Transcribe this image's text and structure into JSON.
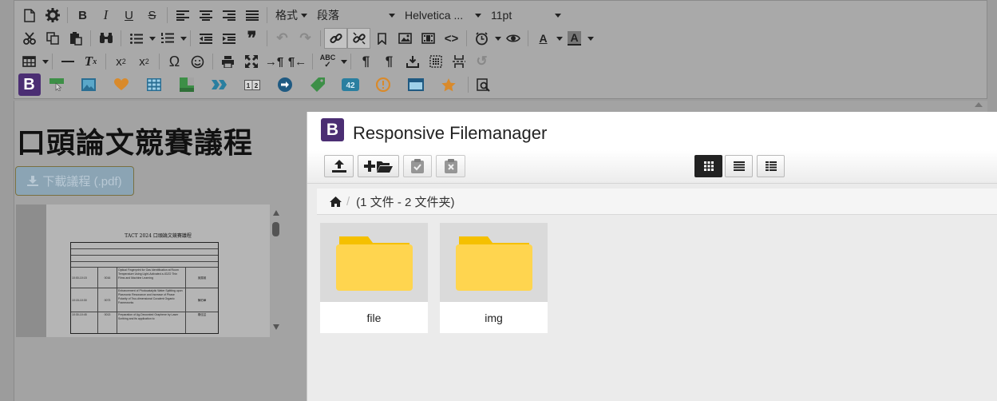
{
  "toolbar": {
    "format_label": "格式",
    "paragraph_label": "段落",
    "font_family": "Helvetica ...",
    "font_size": "11pt"
  },
  "editor": {
    "heading": "口頭論文競賽議程",
    "download_button": "下載議程 (.pdf)",
    "pdf_preview": {
      "title": "TACT 2024  口頭論文競賽議程",
      "rows": [
        {
          "time": "10:00-10:15",
          "id": "0016",
          "paper": "Optical Fingerprint for Gas Identification at Room Temperature Using Light-Activated a-IGZO Thin Films and Machine Learning",
          "speaker": "吳展維"
        },
        {
          "time": "10:15-10:30",
          "id": "0073",
          "paper": "Enhancement of Photocatalytic Water Splitting upon Plasmonic Resonance and Increase of Phase Polarity of Two-dimensional Covalent Organic Frameworks",
          "speaker": "陳柏華"
        },
        {
          "time": "10:30-10:45",
          "id": "0013",
          "paper": "Preparation of Ag-Decorated Graphene by Laser Scribing and its application to",
          "speaker": "楊佳芸"
        }
      ]
    }
  },
  "filemanager": {
    "logo": "B",
    "title": "Responsive Filemanager",
    "breadcrumb_info": "(1 文件 - 2 文件夹)",
    "items": [
      {
        "name": "file",
        "type": "folder"
      },
      {
        "name": "img",
        "type": "folder"
      }
    ],
    "colors": {
      "folder": "#ffd54f",
      "folder_tab": "#f5c000",
      "logo": "#4b2e73"
    }
  }
}
